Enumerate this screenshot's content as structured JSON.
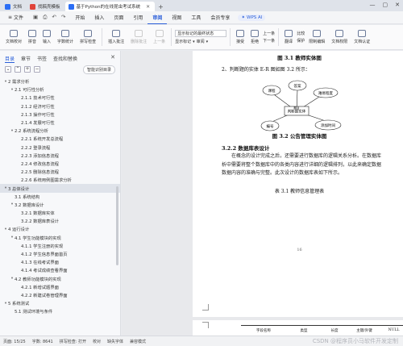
{
  "tabs": [
    {
      "label": "文档",
      "color": "#2b6ef5",
      "active": false
    },
    {
      "label": "找稿壳模板",
      "color": "#e0433a",
      "active": false
    },
    {
      "label": "基于Python的在线昆虫考试系统",
      "color": "#2b6ef5",
      "active": true
    }
  ],
  "window": {
    "min": "—",
    "max": "▢",
    "close": "✕"
  },
  "menubar": {
    "file": "文件",
    "items": [
      "开始",
      "插入",
      "页面",
      "引用",
      "审阅",
      "视图",
      "工具",
      "会员专享"
    ],
    "active": "审阅",
    "ai": "WPS AI"
  },
  "ribbon": {
    "buttons_left": [
      "文档校对",
      "拼音",
      "输入",
      "字数统计",
      "拼写检查"
    ],
    "insert_comment": "插入批注",
    "delete_comment": "删除批注",
    "prev": "上一条",
    "markup_select": "显示标记的最终状态",
    "show_markup": "显示标记",
    "review": "审阅",
    "accept": "接受",
    "reject": "拒绝",
    "prev2": "上一条",
    "next2": "下一条",
    "translate": "翻译",
    "compare": "比较",
    "protect": "保护",
    "restrict": "限制编辑",
    "doc_permission": "文档权限",
    "doc_attach": "文档认证"
  },
  "nav": {
    "tabs": [
      "目录",
      "章节",
      "书签",
      "查找和替换"
    ],
    "smart_button": "智能识别目录",
    "items": [
      {
        "level": 1,
        "text": "2  需求分析",
        "tri": "▾"
      },
      {
        "level": 2,
        "text": "2.1  可行性分析",
        "tri": "▾"
      },
      {
        "level": 3,
        "text": "2.1.1  技术可行性",
        "tri": ""
      },
      {
        "level": 3,
        "text": "2.1.2  经济可行性",
        "tri": ""
      },
      {
        "level": 3,
        "text": "2.1.3  操作可行性",
        "tri": ""
      },
      {
        "level": 3,
        "text": "2.1.4  发展可行性",
        "tri": ""
      },
      {
        "level": 2,
        "text": "2.2  系统流程分析",
        "tri": "▾"
      },
      {
        "level": 3,
        "text": "2.2.1  系统开发总流程",
        "tri": ""
      },
      {
        "level": 3,
        "text": "2.2.2  登录流程",
        "tri": ""
      },
      {
        "level": 3,
        "text": "2.2.3  添加信息流程",
        "tri": ""
      },
      {
        "level": 3,
        "text": "2.2.4  修改信息流程",
        "tri": ""
      },
      {
        "level": 3,
        "text": "2.2.5  删除信息流程",
        "tri": ""
      },
      {
        "level": 3,
        "text": "2.2.6  系统用例图需求分析",
        "tri": ""
      },
      {
        "level": 1,
        "text": "3  总体设计",
        "tri": "▾"
      },
      {
        "level": 2,
        "text": "3.1  系统结构",
        "tri": ""
      },
      {
        "level": 2,
        "text": "3.2  数据库设计",
        "tri": "▾"
      },
      {
        "level": 3,
        "text": "3.2.1  数据库实体",
        "tri": ""
      },
      {
        "level": 3,
        "text": "3.2.2  数据库表设计",
        "tri": ""
      },
      {
        "level": 1,
        "text": "4  运行设计",
        "tri": "▾"
      },
      {
        "level": 2,
        "text": "4.1  学生功能模块的实现",
        "tri": "▾"
      },
      {
        "level": 3,
        "text": "4.1.1  学生注册的实现",
        "tri": ""
      },
      {
        "level": 3,
        "text": "4.1.2  学生信息界面首页",
        "tri": ""
      },
      {
        "level": 3,
        "text": "4.1.3  在线考试界面",
        "tri": ""
      },
      {
        "level": 3,
        "text": "4.1.4  考试成绩查看界面",
        "tri": ""
      },
      {
        "level": 2,
        "text": "4.2  教师功能模块的实现",
        "tri": "▾"
      },
      {
        "level": 3,
        "text": "4.2.1  新增试题界面",
        "tri": ""
      },
      {
        "level": 3,
        "text": "4.2.2  新建试卷管理界面",
        "tri": ""
      },
      {
        "level": 1,
        "text": "5  系统测试",
        "tri": "▾"
      },
      {
        "level": 2,
        "text": "5.1  测试环境与条件",
        "tri": ""
      }
    ],
    "selected_index": 13
  },
  "document": {
    "fig1_caption": "图 3.1 教师实体图",
    "line2": "2、判断题的实体 E-R 图如图 3.2 所示：",
    "er": {
      "center": "判断题实体",
      "nodes": [
        "课程",
        "答案",
        "题目",
        "难易程度",
        "编号",
        "添加时间"
      ]
    },
    "fig2_caption": "图 3.2 公告管理实体图",
    "section_title": "3.2.2  数据库表设计",
    "para_lines": [
      "在概念的设计完成之后，还需要进行数据库的逻辑关系分析。在数据库",
      "析中需要将整个数据库中的各类内容进行详细的逻辑排列，以此来确定数据",
      "数据内容的准确与完整。此次设计的数据库表如下所示。"
    ],
    "table_caption": "表 3.1  教师信息管理表",
    "page_number": "16",
    "table_headers": [
      "字段名称",
      "类型",
      "长度",
      "主键/外键",
      "NULL"
    ]
  },
  "status": {
    "page": "页面: 15/25",
    "words": "字数: 8641",
    "spell": "拼写检查: 打开",
    "proof": "校对",
    "missing_font": "缺失字体",
    "compat": "兼容模式"
  },
  "watermark": "CSDN @程序员小马软件开发定制"
}
